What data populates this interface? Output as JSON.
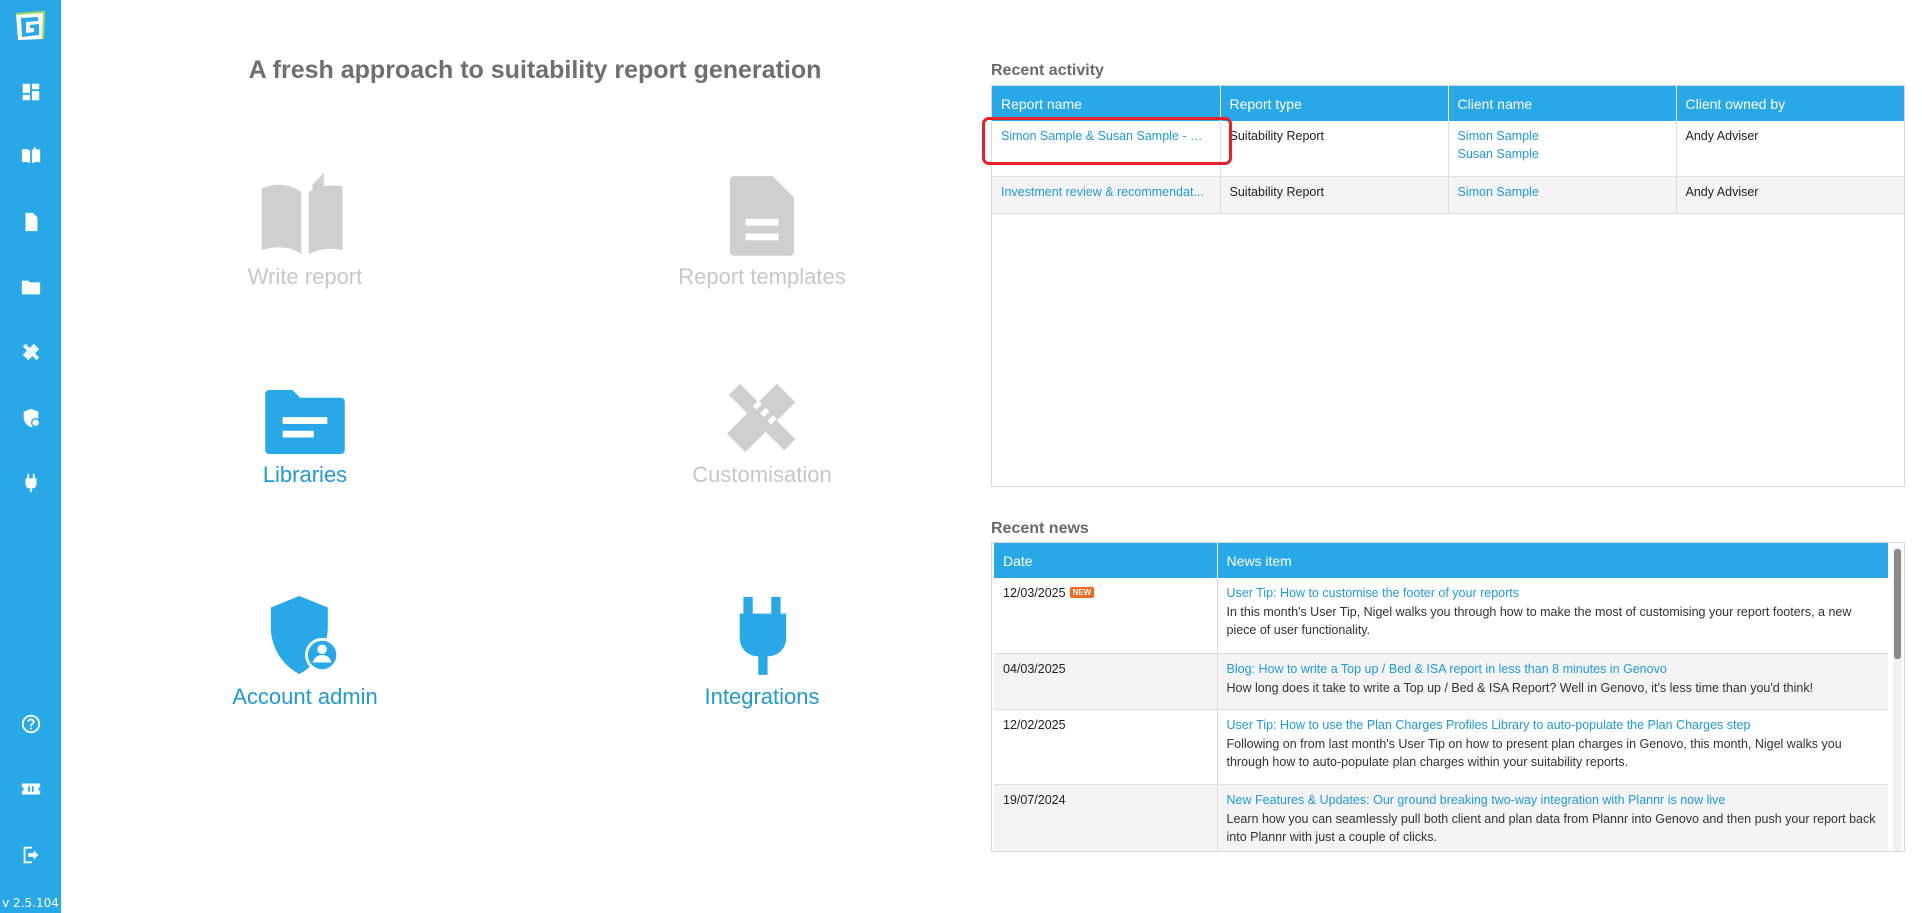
{
  "app": {
    "version": "v 2.5.104"
  },
  "sidebar": {
    "items": [
      {
        "name": "dashboard",
        "icon": "dashboard-icon"
      },
      {
        "name": "write-report",
        "icon": "book-icon"
      },
      {
        "name": "report-templates",
        "icon": "document-icon"
      },
      {
        "name": "libraries",
        "icon": "folder-icon"
      },
      {
        "name": "customisation",
        "icon": "tools-icon"
      },
      {
        "name": "account-admin",
        "icon": "shield-user-icon"
      },
      {
        "name": "integrations",
        "icon": "plug-icon"
      },
      {
        "name": "help",
        "icon": "help-icon"
      },
      {
        "name": "tickets",
        "icon": "ticket-icon"
      },
      {
        "name": "logout",
        "icon": "logout-icon"
      }
    ]
  },
  "main": {
    "headline": "A fresh approach to suitability report generation",
    "tiles": [
      {
        "label": "Write report",
        "state": "disabled"
      },
      {
        "label": "Report templates",
        "state": "disabled"
      },
      {
        "label": "Libraries",
        "state": "active"
      },
      {
        "label": "Customisation",
        "state": "disabled"
      },
      {
        "label": "Account admin",
        "state": "active"
      },
      {
        "label": "Integrations",
        "state": "active"
      }
    ]
  },
  "recent_activity": {
    "title": "Recent activity",
    "columns": [
      "Report name",
      "Report type",
      "Client name",
      "Client owned by"
    ],
    "rows": [
      {
        "report_name": "Simon Sample & Susan Sample - Su...",
        "report_type": "Suitability Report",
        "client_names": [
          "Simon Sample",
          "Susan Sample"
        ],
        "owner": "Andy Adviser"
      },
      {
        "report_name": "Investment review & recommendat...",
        "report_type": "Suitability Report",
        "client_names": [
          "Simon Sample"
        ],
        "owner": "Andy Adviser"
      }
    ]
  },
  "recent_news": {
    "title": "Recent news",
    "columns": [
      "Date",
      "News item"
    ],
    "badge_label": "NEW",
    "rows": [
      {
        "date": "12/03/2025",
        "is_new": true,
        "title": "User Tip: How to customise the footer of your reports",
        "body": "In this month's User Tip, Nigel walks you through how to make the most of customising your report footers, a new piece of user functionality."
      },
      {
        "date": "04/03/2025",
        "is_new": false,
        "title": "Blog: How to write a Top up / Bed & ISA report in less than 8 minutes in Genovo",
        "body": "How long does it take to write a Top up / Bed & ISA Report? Well in Genovo, it's less time than you'd think!"
      },
      {
        "date": "12/02/2025",
        "is_new": false,
        "title": "User Tip: How to use the Plan Charges Profiles Library to auto-populate the Plan Charges step",
        "body": "Following on from last month's User Tip on how to present plan charges in Genovo, this month, Nigel walks you through how to auto-populate plan charges within your suitability reports."
      },
      {
        "date": "19/07/2024",
        "is_new": false,
        "title": "New Features & Updates: Our ground breaking two-way integration with Plannr is now live",
        "body": "Learn how you can seamlessly pull both client and plan data from Plannr into Genovo and then push your report back into Plannr with just a couple of clicks."
      }
    ]
  },
  "colors": {
    "brand": "#29a8e8",
    "link": "#2399d6",
    "disabled": "#cfcfcf",
    "highlight": "#e8202a",
    "new_badge": "#f26a22"
  }
}
